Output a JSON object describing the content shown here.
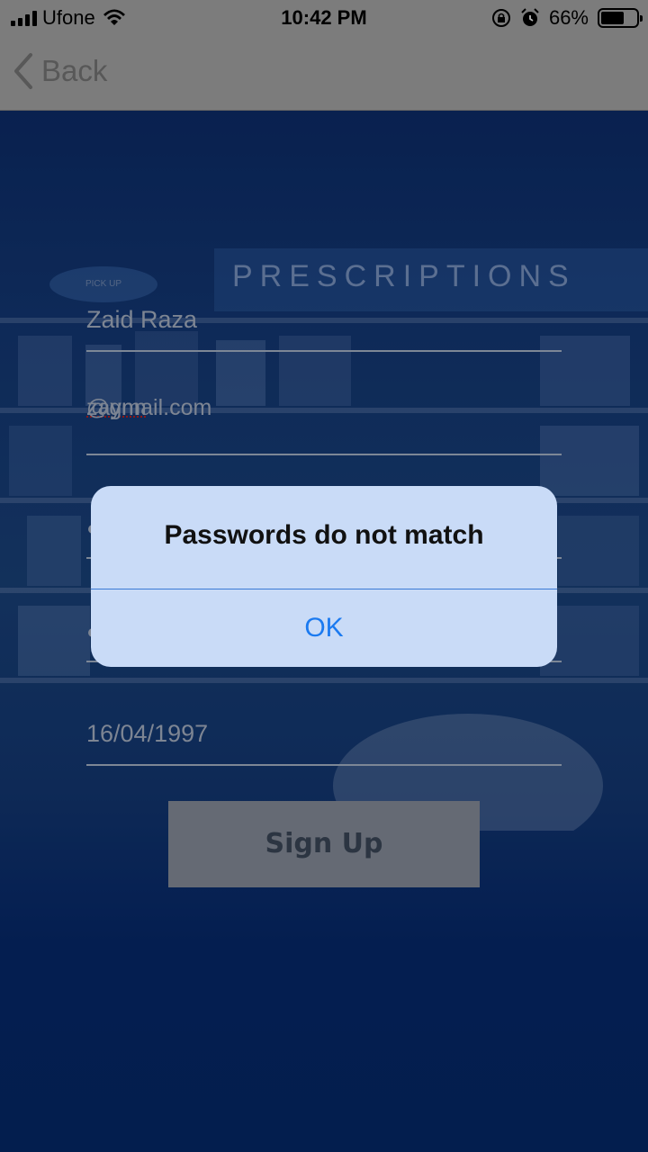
{
  "status_bar": {
    "carrier": "Ufone",
    "time": "10:42 PM",
    "battery_percent": "66%",
    "battery_level": 0.66
  },
  "nav": {
    "back_label": "Back"
  },
  "background": {
    "sign_text": "PRESCRIPTIONS",
    "pickup_text": "PICK UP"
  },
  "form": {
    "name_value": "Zaid Raza",
    "email_value": "zaynn@gmail.com",
    "email_misspelled": "zaynn",
    "email_rest": "@gmail.com",
    "dob_value": "16/04/1997"
  },
  "signup": {
    "label": "Sign Up"
  },
  "alert": {
    "title": "Passwords do not match",
    "ok_label": "OK"
  }
}
